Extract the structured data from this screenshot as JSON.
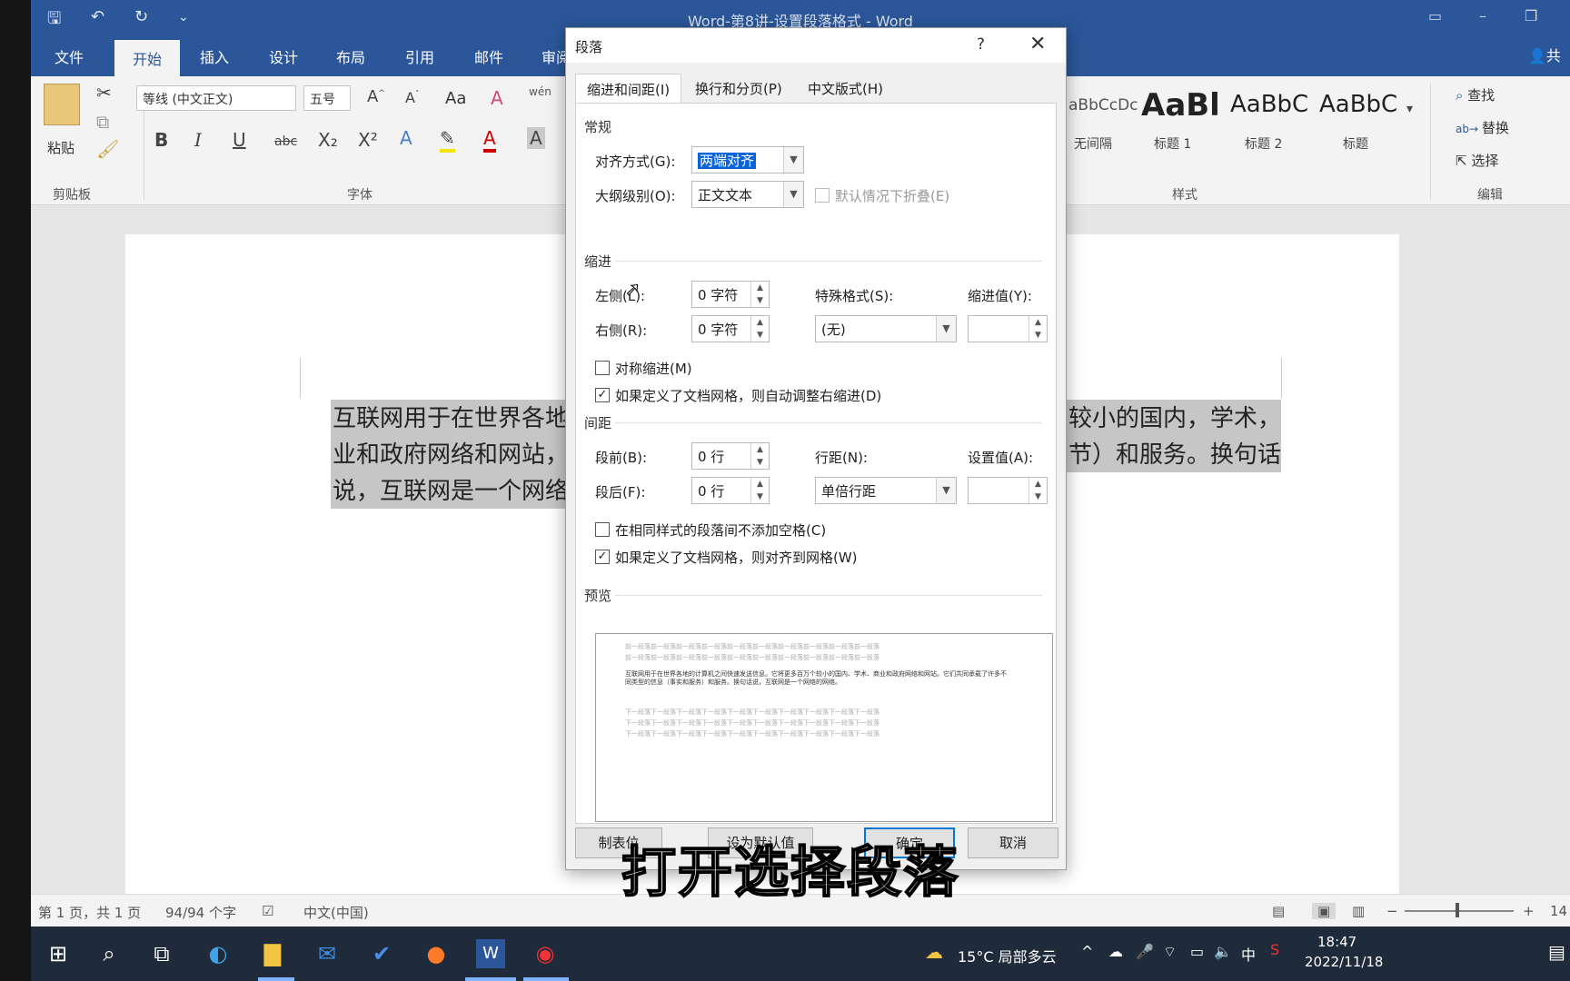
{
  "window": {
    "title": "Word-第8讲-设置段落格式 - Word",
    "quick_access": [
      "save-icon",
      "undo-icon",
      "redo-icon",
      "customize-icon"
    ],
    "share_label": "共"
  },
  "ribbon_tabs": [
    "文件",
    "开始",
    "插入",
    "设计",
    "布局",
    "引用",
    "邮件",
    "审阅"
  ],
  "active_tab": "开始",
  "ribbon": {
    "clipboard": {
      "paste_label": "粘贴",
      "group_label": "剪贴板"
    },
    "font": {
      "font_name": "等线 (中文正文)",
      "font_size": "五号",
      "group_label": "字体",
      "buttons": [
        "B",
        "I",
        "U",
        "abc",
        "X₂",
        "X²",
        "A",
        "A",
        "A"
      ],
      "case_label": "Aa",
      "phonetic_label": "wén"
    },
    "styles": {
      "group_label": "样式",
      "items": [
        {
          "sample": "aBbCcDc",
          "name": "无间隔"
        },
        {
          "sample": "AaBl",
          "name": "标题 1"
        },
        {
          "sample": "AaBbC",
          "name": "标题 2"
        },
        {
          "sample": "AaBbC",
          "name": "标题"
        }
      ]
    },
    "editing": {
      "group_label": "编辑",
      "find": "查找",
      "replace": "替换",
      "select": "选择"
    }
  },
  "document": {
    "lines": [
      {
        "left": "互联网用于在世界各地",
        "right": "较小的国内，学术，商"
      },
      {
        "left": "业和政府网络和网站，",
        "right": "节）和服务。换句话"
      },
      {
        "left": "说，互联网是一个网络",
        "right": ""
      }
    ]
  },
  "statusbar": {
    "page": "第 1 页，共 1 页",
    "words": "94/94 个字",
    "language": "中文(中国)",
    "zoom": "14"
  },
  "dialog": {
    "title": "段落",
    "help": "?",
    "close": "✕",
    "tabs": [
      "缩进和间距(I)",
      "换行和分页(P)",
      "中文版式(H)"
    ],
    "active_tab_index": 0,
    "general": {
      "section": "常规",
      "alignment_label": "对齐方式(G):",
      "alignment_value": "两端对齐",
      "outline_label": "大纲级别(O):",
      "outline_value": "正文文本",
      "collapse_label": "默认情况下折叠(E)",
      "collapse_checked": false
    },
    "indent": {
      "section": "缩进",
      "left_label": "左侧(L):",
      "left_value": "0 字符",
      "right_label": "右侧(R):",
      "right_value": "0 字符",
      "special_label": "特殊格式(S):",
      "special_value": "(无)",
      "by_label": "缩进值(Y):",
      "by_value": "",
      "mirror_label": "对称缩进(M)",
      "mirror_checked": false,
      "auto_adjust_label": "如果定义了文档网格，则自动调整右缩进(D)",
      "auto_adjust_checked": true
    },
    "spacing": {
      "section": "间距",
      "before_label": "段前(B):",
      "before_value": "0 行",
      "after_label": "段后(F):",
      "after_value": "0 行",
      "line_label": "行距(N):",
      "line_value": "单倍行距",
      "at_label": "设置值(A):",
      "at_value": "",
      "no_space_label": "在相同样式的段落间不添加空格(C)",
      "no_space_checked": false,
      "snap_grid_label": "如果定义了文档网格，则对齐到网格(W)",
      "snap_grid_checked": true
    },
    "preview": {
      "section": "预览",
      "prev_text": "前一段落前一段落前一段落前一段落前一段落前一段落前一段落前一段落前一段落前一段落",
      "current_text": "互联网用于在世界各地的计算机之间快速发送信息。它将更多百万个较小的国内、学术、商业和政府网络和网站。它们共同承载了许多不同类型的信息（事实和服务）和服务。换句话说，互联网是一个网络的网络。",
      "next_text": "下一段落下一段落下一段落下一段落下一段落下一段落下一段落下一段落下一段落下一段落"
    },
    "buttons": {
      "tabs": "制表位",
      "default": "设为默认值",
      "ok": "确定",
      "cancel": "取消"
    }
  },
  "taskbar": {
    "weather": "15°C  局部多云",
    "time": "18:47",
    "date": "2022/11/18",
    "ime": "中"
  },
  "subtitle": "打开选择段落"
}
